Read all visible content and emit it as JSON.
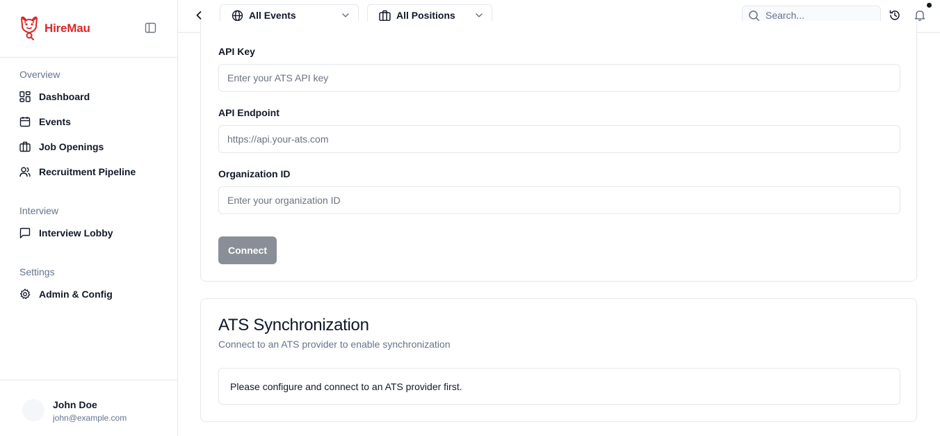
{
  "app": {
    "brand_name": "HireMau",
    "brand_color": "#dc2626"
  },
  "sidebar": {
    "sections": [
      {
        "label": "Overview",
        "items": [
          {
            "label": "Dashboard",
            "icon": "dashboard-grid-icon"
          },
          {
            "label": "Events",
            "icon": "calendar-icon"
          },
          {
            "label": "Job Openings",
            "icon": "briefcase-icon"
          },
          {
            "label": "Recruitment Pipeline",
            "icon": "users-icon"
          }
        ]
      },
      {
        "label": "Interview",
        "items": [
          {
            "label": "Interview Lobby",
            "icon": "message-square-icon"
          }
        ]
      },
      {
        "label": "Settings",
        "items": [
          {
            "label": "Admin & Config",
            "icon": "gear-icon"
          }
        ]
      }
    ],
    "user": {
      "name": "John Doe",
      "email": "john@example.com"
    }
  },
  "topbar": {
    "events_filter": {
      "value": "All Events",
      "icon": "globe-icon"
    },
    "positions_filter": {
      "value": "All Positions",
      "icon": "briefcase-icon"
    },
    "search": {
      "placeholder": "Search...",
      "value": ""
    },
    "icons": [
      "chevron-left-icon",
      "search-icon",
      "history-icon",
      "bell-icon"
    ]
  },
  "ats_config": {
    "fields": [
      {
        "label": "API Key",
        "placeholder": "Enter your ATS API key",
        "value": ""
      },
      {
        "label": "API Endpoint",
        "placeholder": "https://api.your-ats.com",
        "value": ""
      },
      {
        "label": "Organization ID",
        "placeholder": "Enter your organization ID",
        "value": ""
      }
    ],
    "connect_label": "Connect",
    "connect_color": "#8a8f97"
  },
  "ats_sync": {
    "title": "ATS Synchronization",
    "description": "Connect to an ATS provider to enable synchronization",
    "notice": "Please configure and connect to an ATS provider first."
  }
}
